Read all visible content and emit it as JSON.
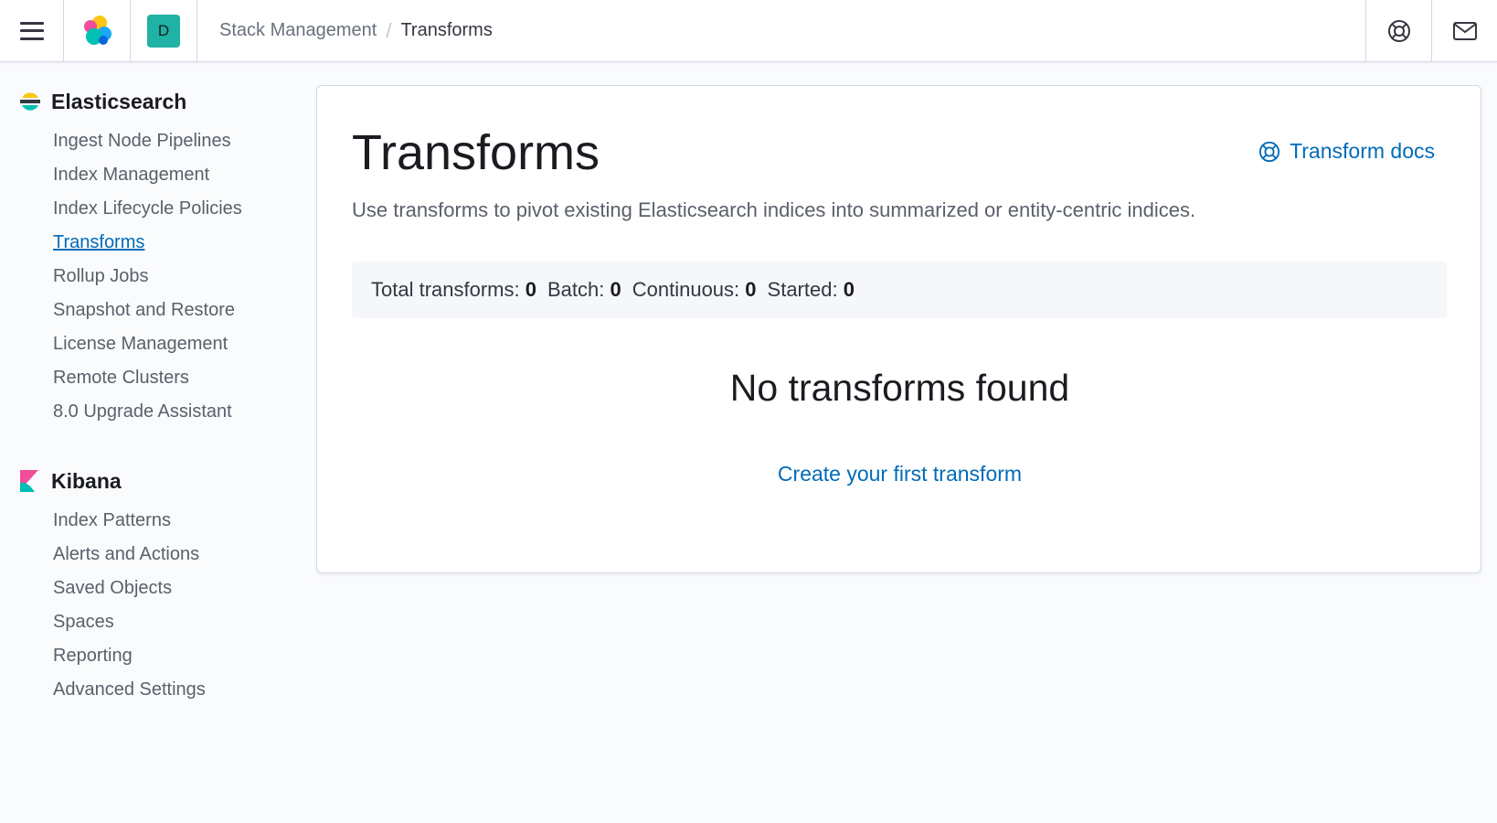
{
  "header": {
    "breadcrumbs": [
      {
        "label": "Stack Management"
      },
      {
        "label": "Transforms"
      }
    ],
    "avatar_letter": "D"
  },
  "sidebar": {
    "groups": [
      {
        "title": "Elasticsearch",
        "items": [
          {
            "label": "Ingest Node Pipelines"
          },
          {
            "label": "Index Management"
          },
          {
            "label": "Index Lifecycle Policies"
          },
          {
            "label": "Transforms",
            "active": true
          },
          {
            "label": "Rollup Jobs"
          },
          {
            "label": "Snapshot and Restore"
          },
          {
            "label": "License Management"
          },
          {
            "label": "Remote Clusters"
          },
          {
            "label": "8.0 Upgrade Assistant"
          }
        ]
      },
      {
        "title": "Kibana",
        "items": [
          {
            "label": "Index Patterns"
          },
          {
            "label": "Alerts and Actions"
          },
          {
            "label": "Saved Objects"
          },
          {
            "label": "Spaces"
          },
          {
            "label": "Reporting"
          },
          {
            "label": "Advanced Settings"
          }
        ]
      }
    ]
  },
  "main": {
    "title": "Transforms",
    "docs_link": "Transform docs",
    "description": "Use transforms to pivot existing Elasticsearch indices into summarized or entity-centric indices.",
    "stats": [
      {
        "label": "Total transforms:",
        "value": "0"
      },
      {
        "label": "Batch:",
        "value": "0"
      },
      {
        "label": "Continuous:",
        "value": "0"
      },
      {
        "label": "Started:",
        "value": "0"
      }
    ],
    "empty_title": "No transforms found",
    "create_link": "Create your first transform"
  },
  "colors": {
    "link": "#006bb8",
    "avatar": "#20b2a4"
  }
}
